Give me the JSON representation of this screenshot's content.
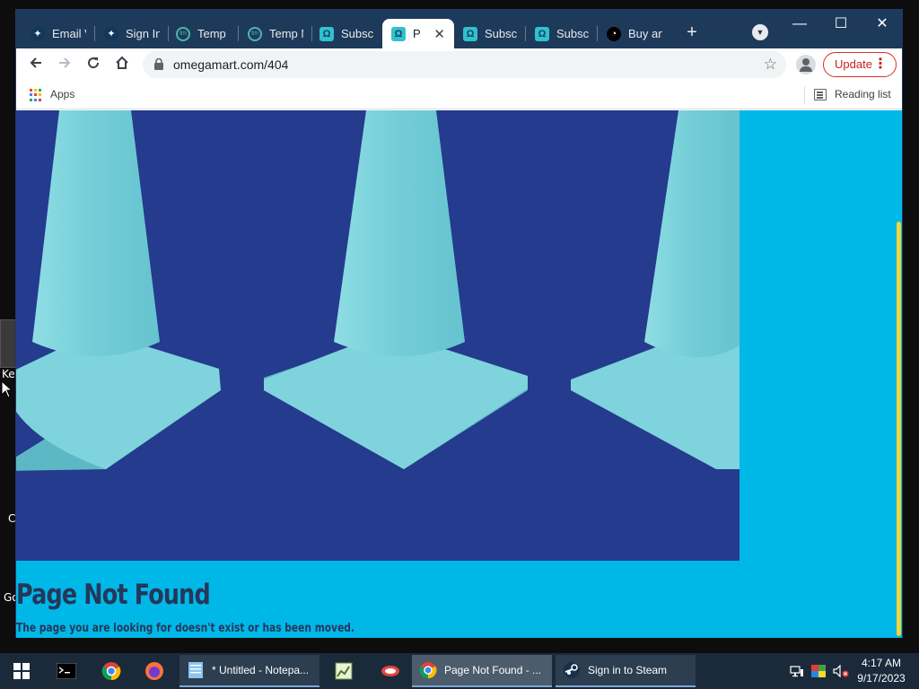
{
  "desktop": {
    "fragments": [
      "Ke",
      "C",
      "Go"
    ]
  },
  "browser": {
    "tabs": [
      {
        "title": "Email V",
        "favicon": "steam-icon",
        "active": false
      },
      {
        "title": "Sign In",
        "favicon": "steam-icon",
        "active": false
      },
      {
        "title": "Temp M",
        "favicon": "temp-mail-icon",
        "active": false
      },
      {
        "title": "Temp M",
        "favicon": "temp-mail-icon",
        "active": false
      },
      {
        "title": "Subscri",
        "favicon": "omega-icon",
        "active": false
      },
      {
        "title": "Pag",
        "favicon": "omega-icon",
        "active": true
      },
      {
        "title": "Subscri",
        "favicon": "omega-icon",
        "active": false
      },
      {
        "title": "Subscri",
        "favicon": "omega-icon",
        "active": false
      },
      {
        "title": "Buy anc",
        "favicon": "buy-icon",
        "active": false
      }
    ],
    "newtab_symbol": "+",
    "window_controls": {
      "minimize": "—",
      "maximize": "☐",
      "close": "✕"
    },
    "toolbar": {
      "url": "omegamart.com/404",
      "update_label": "Update"
    },
    "bookmarks": {
      "apps_label": "Apps",
      "reading_list_label": "Reading list"
    }
  },
  "page": {
    "title": "Page Not Found",
    "subtitle": "The page you are looking for doesn't exist or has been moved."
  },
  "taskbar": {
    "items": [
      {
        "label": "* Untitled - Notepa...",
        "icon": "notepad-icon"
      },
      {
        "label": "Page Not Found - ...",
        "icon": "chrome-icon",
        "active": true
      },
      {
        "label": "Sign in to Steam",
        "icon": "steam-icon"
      }
    ],
    "clock": {
      "time": "4:17 AM",
      "date": "9/17/2023"
    }
  },
  "colors": {
    "tabstrip": "#1e3a5a",
    "hero": "#243b8e",
    "page_bg": "#00b8e8",
    "cone": "#7fd3dc",
    "title_text": "#25375a"
  }
}
